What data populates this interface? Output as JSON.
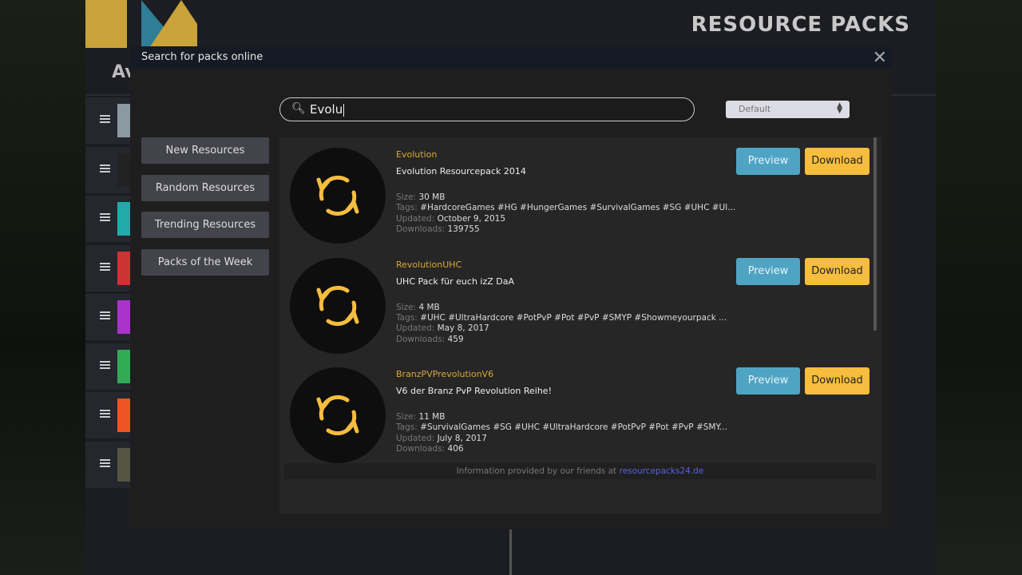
{
  "header": {
    "title": "RESOURCE PACKS",
    "section_partial": "Av"
  },
  "modal": {
    "title": "Search for packs online",
    "close_icon": "close-icon"
  },
  "search": {
    "value": "Evolu",
    "icon": "search-icon"
  },
  "sort": {
    "selected": "Default"
  },
  "nav": [
    {
      "label": "New Resources"
    },
    {
      "label": "Random Resources"
    },
    {
      "label": "Trending Resources"
    },
    {
      "label": "Packs of the Week"
    }
  ],
  "labels": {
    "size": "Size:",
    "tags": "Tags:",
    "updated": "Updated:",
    "downloads": "Downloads:",
    "preview": "Preview",
    "download": "Download"
  },
  "packs": [
    {
      "name": "Evolution",
      "description": "Evolution Resourcepack 2014",
      "size": "30 MB",
      "tags": "#HardcoreGames #HG #HungerGames #SurvivalGames #SG #UHC #Ul...",
      "updated": "October 9, 2015",
      "downloads": "139755"
    },
    {
      "name": "RevolutionUHC",
      "description": "UHC Pack für euch izZ DaA",
      "size": "4 MB",
      "tags": "#UHC #UltraHardcore #PotPvP #Pot #PvP #SMYP #Showmeyourpack ...",
      "updated": "May 8, 2017",
      "downloads": "459"
    },
    {
      "name": "BranzPVPrevolutionV6",
      "description": "V6 der Branz PvP Revolution Reihe!",
      "size": "11 MB",
      "tags": "#SurvivalGames #SG #UHC #UltraHardcore #PotPvP #Pot #PvP #SMY...",
      "updated": "July 8, 2017",
      "downloads": "406"
    }
  ],
  "footer": {
    "text": "Information provided by our friends at ",
    "link": "resourcepacks24.de"
  },
  "colors": {
    "accent": "#f6bd3e",
    "preview": "#4fa4c4",
    "link": "#5a63d8"
  }
}
